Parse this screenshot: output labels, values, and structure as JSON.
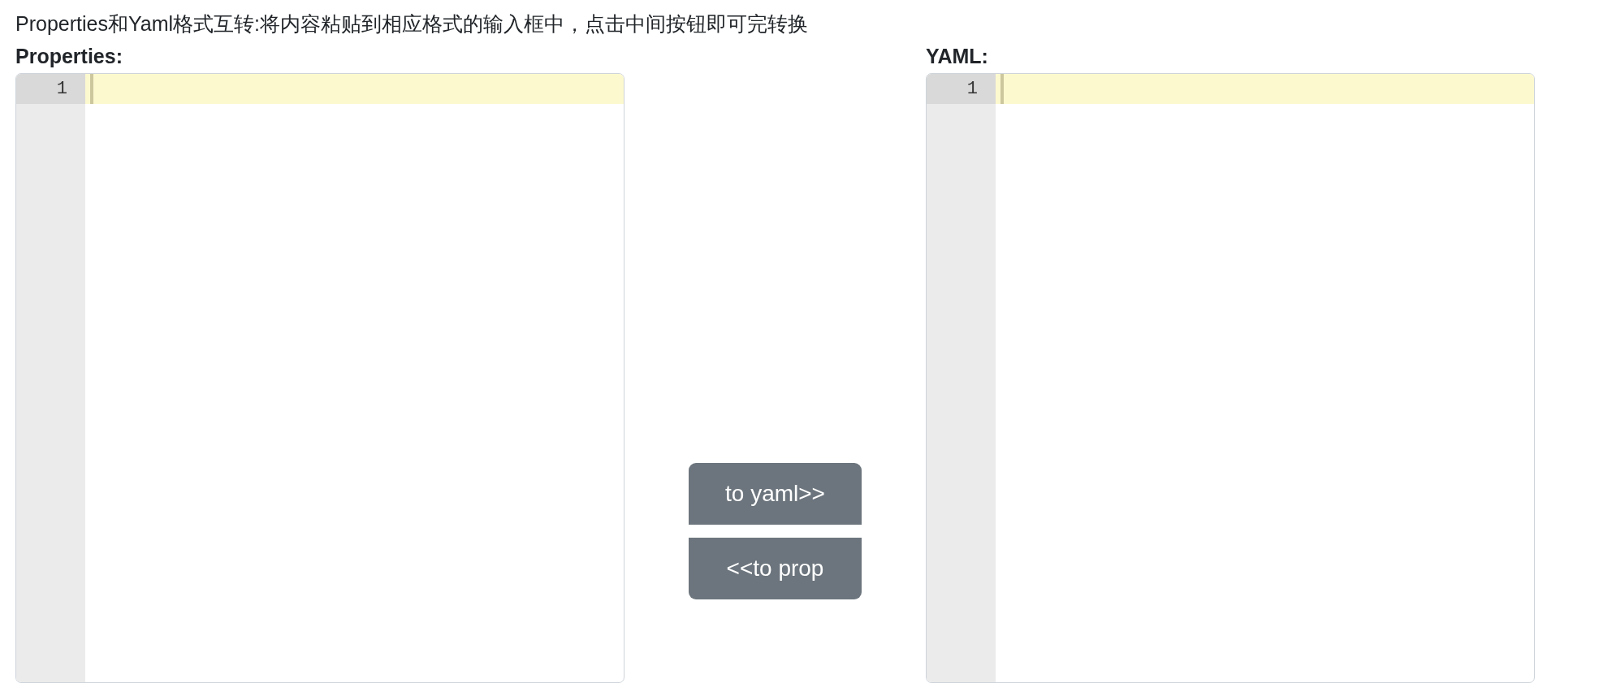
{
  "heading": "Properties和Yaml格式互转:将内容粘贴到相应格式的输入框中，点击中间按钮即可完转换",
  "editors": [
    {
      "label": "Properties:",
      "lines": [
        {
          "number": "1",
          "active": true
        }
      ]
    },
    {
      "label": "YAML:",
      "lines": [
        {
          "number": "1",
          "active": true
        }
      ]
    }
  ],
  "buttons": [
    {
      "label": "to yaml>>"
    },
    {
      "label": "<<to prop"
    }
  ]
}
